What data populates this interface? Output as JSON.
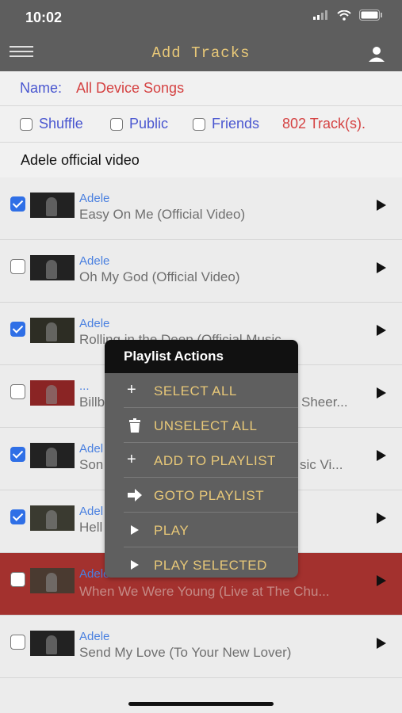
{
  "status": {
    "time": "10:02"
  },
  "nav": {
    "title": "Add Tracks"
  },
  "name_bar": {
    "label": "Name:",
    "value": "All Device Songs"
  },
  "options": {
    "shuffle": "Shuffle",
    "public": "Public",
    "friends": "Friends",
    "track_count": "802 Track(s)."
  },
  "search": {
    "text": "Adele official video"
  },
  "tracks": [
    {
      "artist": "Adele",
      "title": "Easy On Me (Official Video)",
      "checked": true
    },
    {
      "artist": "Adele",
      "title": "Oh My God (Official Video)",
      "checked": false
    },
    {
      "artist": "Adele",
      "title": "Rolling in the Deep (Official Music...",
      "checked": true
    },
    {
      "artist": "...",
      "title": "Billb",
      "title_right": "Sheer...",
      "checked": false
    },
    {
      "artist": "Adel",
      "title": "Son",
      "title_right": "sic Vi...",
      "checked": true
    },
    {
      "artist": "Adel",
      "title": "Hell",
      "checked": true
    },
    {
      "artist": "Adele",
      "title": "When We Were Young (Live at The Chu...",
      "checked": false,
      "highlighted": true
    },
    {
      "artist": "Adele",
      "title": "Send My Love (To Your New Lover)",
      "checked": false
    }
  ],
  "menu": {
    "title": "Playlist Actions",
    "items": [
      {
        "icon": "plus-icon",
        "label": "SELECT ALL"
      },
      {
        "icon": "trash-icon",
        "label": "UNSELECT ALL"
      },
      {
        "icon": "plus-icon",
        "label": "ADD TO PLAYLIST"
      },
      {
        "icon": "arrow-right-icon",
        "label": "GOTO PLAYLIST"
      },
      {
        "icon": "play-icon",
        "label": "PLAY"
      },
      {
        "icon": "play-icon",
        "label": "PLAY SELECTED"
      }
    ]
  },
  "colors": {
    "accent_blue": "#4a57d0",
    "accent_red": "#d54242",
    "nav_bg": "#5e5e5e",
    "nav_title": "#e8c878",
    "highlight_row": "#a3312e"
  }
}
